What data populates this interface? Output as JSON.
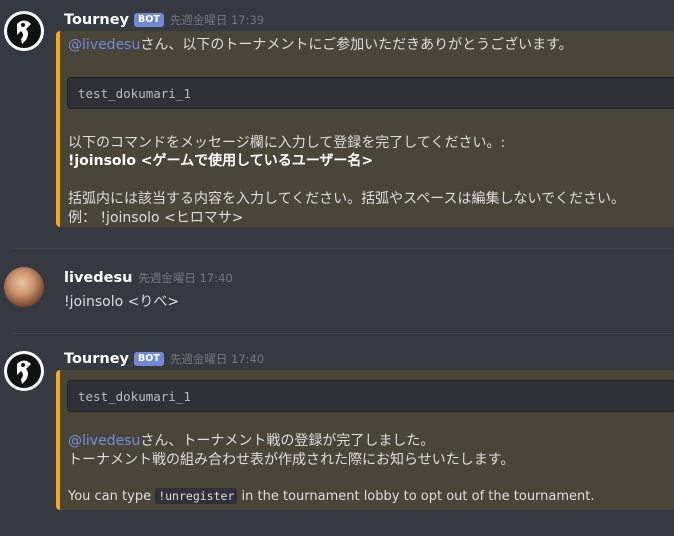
{
  "colors": {
    "background": "#36393f",
    "embed_accent": "#faa61a",
    "embed_background": "#4a4539",
    "mention": "#7289da",
    "bot_badge": "#7289da"
  },
  "messages": [
    {
      "username": "Tourney",
      "badge": "BOT",
      "timestamp": "先週金曜日 17:39",
      "avatar_icon": "tourney-logo-icon",
      "embed": {
        "mention": "@livedesu",
        "line1_rest": "さん、以下のトーナメントにご参加いただきありがとうございます。",
        "code": "test_dokumari_1",
        "line2": "以下のコマンドをメッセージ欄に入力して登録を完了してください。:",
        "command": "!joinsolo <ゲームで使用しているユーザー名>",
        "line3": "括弧内には該当する内容を入力してください。括弧やスペースは編集しないでください。",
        "line4": "例： !joinsolo <ヒロマサ>"
      }
    },
    {
      "username": "livedesu",
      "timestamp": "先週金曜日 17:40",
      "avatar_icon": "user-photo-avatar",
      "text": "!joinsolo <りべ>"
    },
    {
      "username": "Tourney",
      "badge": "BOT",
      "timestamp": "先週金曜日 17:40",
      "avatar_icon": "tourney-logo-icon",
      "embed": {
        "code": "test_dokumari_1",
        "mention": "@livedesu",
        "line1_rest": "さん、トーナメント戦の登録が完了しました。",
        "line2": "トーナメント戦の組み合わせ表が作成された際にお知らせいたします。",
        "line3_pre": "You can type ",
        "line3_code": "!unregister",
        "line3_post": " in the tournament lobby to opt out of the tournament."
      }
    }
  ]
}
